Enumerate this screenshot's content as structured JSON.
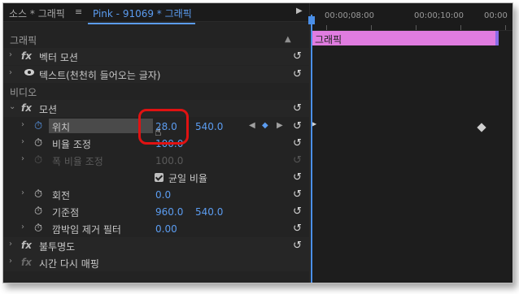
{
  "tabs": {
    "source": "소스 * 그래픽",
    "menu": "≡",
    "sequence": "Pink - 91069 * 그래픽"
  },
  "timeline": {
    "timecodes": [
      "00:00;08:00",
      "00:00;10:00",
      "00:00"
    ],
    "clip_label": "그래픽"
  },
  "sections": {
    "graphic": "그래픽",
    "video": "비디오"
  },
  "effects": {
    "vector_motion": "벡터 모션",
    "text": "텍스트(천천히 들어오는 글자)",
    "motion": "모션",
    "opacity": "불투명도",
    "time_remap": "시간 다시 매핑"
  },
  "properties": {
    "position": {
      "label": "위치",
      "x": "28.0",
      "y": "540.0"
    },
    "scale": {
      "label": "비율 조정",
      "value": "100.0"
    },
    "scale_width": {
      "label": "폭 비율 조정",
      "value": "100.0"
    },
    "uniform_scale": {
      "label": "균일 비율"
    },
    "rotation": {
      "label": "회전",
      "value": "0.0"
    },
    "anchor": {
      "label": "기준점",
      "x": "960.0",
      "y": "540.0"
    },
    "flicker": {
      "label": "깜박임 제거 필터",
      "value": "0.00"
    }
  },
  "colors": {
    "accent": "#5b9cf0",
    "clip": "#e07ce0",
    "annotation": "#e01212"
  }
}
